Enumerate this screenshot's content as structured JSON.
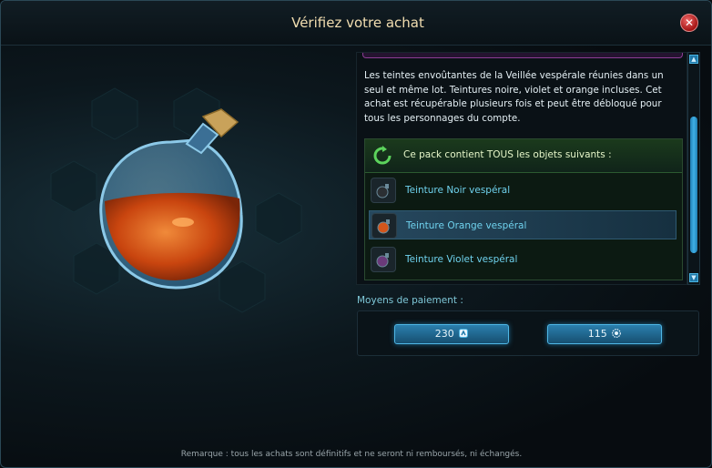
{
  "window": {
    "title": "Vérifiez votre achat",
    "close_icon": "close-icon"
  },
  "description": "Les teintes envoûtantes de la Veillée vespérale réunies dans un seul et même lot. Teintures noire, violet et orange incluses. Cet achat est récupérable plusieurs fois et peut être débloqué pour tous les personnages du compte.",
  "pack": {
    "header": "Ce pack contient TOUS les objets suivants :",
    "items": [
      {
        "label": "Teinture Noir vespéral",
        "icon": "dye-black-icon",
        "color": "#2b2f33"
      },
      {
        "label": "Teinture Orange vespéral",
        "icon": "dye-orange-icon",
        "color": "#d2561c",
        "selected": true
      },
      {
        "label": "Teinture Violet vespéral",
        "icon": "dye-violet-icon",
        "color": "#6a3a7a"
      }
    ]
  },
  "payment": {
    "label": "Moyens de paiement :",
    "options": [
      {
        "amount": "230",
        "icon": "currency-a-icon"
      },
      {
        "amount": "115",
        "icon": "currency-b-icon"
      }
    ]
  },
  "footer": "Remarque : tous les achats sont définitifs et ne seront ni remboursés, ni échangés.",
  "colors": {
    "title": "#f1ddb0",
    "accent": "#3fb0e6",
    "item_text": "#6fd2ee",
    "close": "#c0392b"
  }
}
